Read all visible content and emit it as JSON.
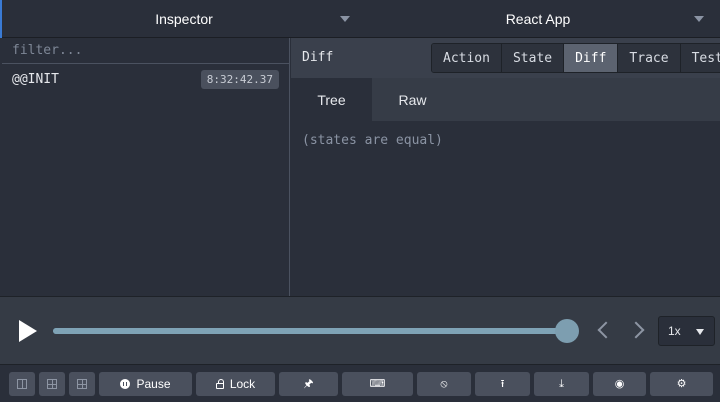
{
  "header": {
    "left_select": "Inspector",
    "right_select": "React App"
  },
  "actions_pane": {
    "filter_placeholder": "filter...",
    "items": [
      {
        "name": "@@INIT",
        "time": "8:32:42.37"
      }
    ]
  },
  "monitor": {
    "title": "Diff",
    "tabs": [
      "Action",
      "State",
      "Diff",
      "Trace",
      "Test"
    ],
    "active_tab": "Diff",
    "subtabs": [
      "Tree",
      "Raw"
    ],
    "active_subtab": "Tree",
    "message": "(states are equal)"
  },
  "slider": {
    "progress": 1.0,
    "speed": "1x"
  },
  "toolbar": {
    "pause_label": "Pause",
    "lock_label": "Lock",
    "icons": [
      "layout-left-icon",
      "layout-grid-icon",
      "layout-grid-icon",
      "pause-icon",
      "lock-icon",
      "pin-icon",
      "keyboard-icon",
      "timer-off-icon",
      "upload-icon",
      "download-icon",
      "broadcast-icon",
      "gear-icon"
    ]
  },
  "colors": {
    "background": "#2a2f3a",
    "header_bar": "#3a404c",
    "active_tab": "#5c6370",
    "slider_track": "#5b7f91",
    "button": "#4a505d",
    "accent": "#3a7bd5"
  }
}
